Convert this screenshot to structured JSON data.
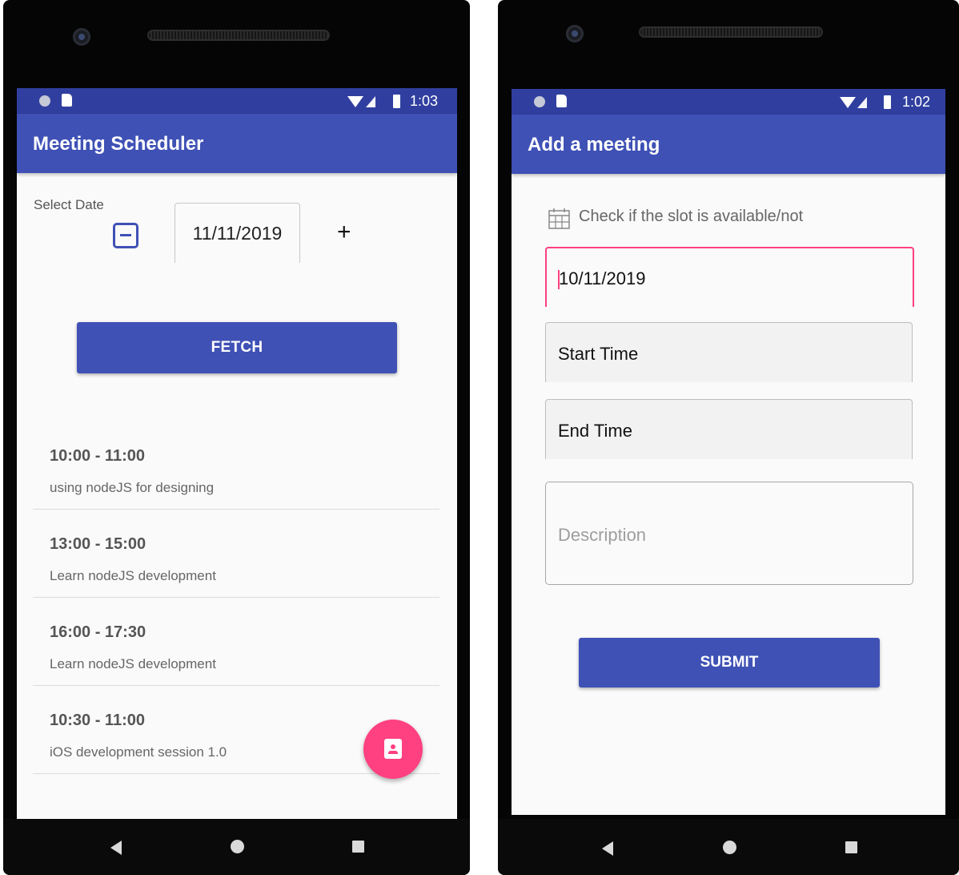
{
  "left_screen": {
    "status_time": "1:03",
    "app_title": "Meeting Scheduler",
    "select_date_label": "Select Date",
    "date_value": "11/11/2019",
    "plus_label": "+",
    "fetch_label": "FETCH",
    "meetings": [
      {
        "time": "10:00 - 11:00",
        "description": "using nodeJS for designing"
      },
      {
        "time": "13:00 - 15:00",
        "description": "Learn nodeJS development"
      },
      {
        "time": "16:00 - 17:30",
        "description": "Learn nodeJS development"
      },
      {
        "time": "10:30 - 11:00",
        "description": "iOS development session 1.0"
      }
    ],
    "fab_icon": "contact-calendar-icon"
  },
  "right_screen": {
    "status_time": "1:02",
    "app_title": "Add a meeting",
    "check_slot_label": "Check if the slot is available/not",
    "date_value": "10/11/2019",
    "start_time_label": "Start Time",
    "end_time_label": "End Time",
    "description_placeholder": "Description",
    "submit_label": "SUBMIT"
  },
  "colors": {
    "primary": "#3f51b5",
    "primary_dark": "#303f9f",
    "accent": "#ff4081"
  }
}
